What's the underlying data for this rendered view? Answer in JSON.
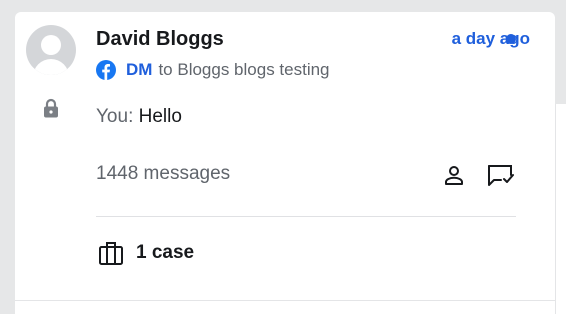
{
  "conversation": {
    "contact_name": "David Bloggs",
    "timestamp": "a day ago",
    "channel": "DM",
    "destination": "to Bloggs blogs testing",
    "preview_sender": "You:",
    "preview_text": "Hello",
    "message_count": "1448 messages",
    "case_count": "1 case",
    "unread": true,
    "icons": {
      "avatar": "avatar-placeholder",
      "lock": "lock-icon",
      "channel": "facebook-icon",
      "contact": "person-icon",
      "reply": "reply-bubble-icon",
      "case": "briefcase-icon"
    }
  },
  "colors": {
    "accent": "#1f5fdc",
    "text": "#17191c",
    "muted": "#60656c",
    "background": "#e6e7e8"
  }
}
